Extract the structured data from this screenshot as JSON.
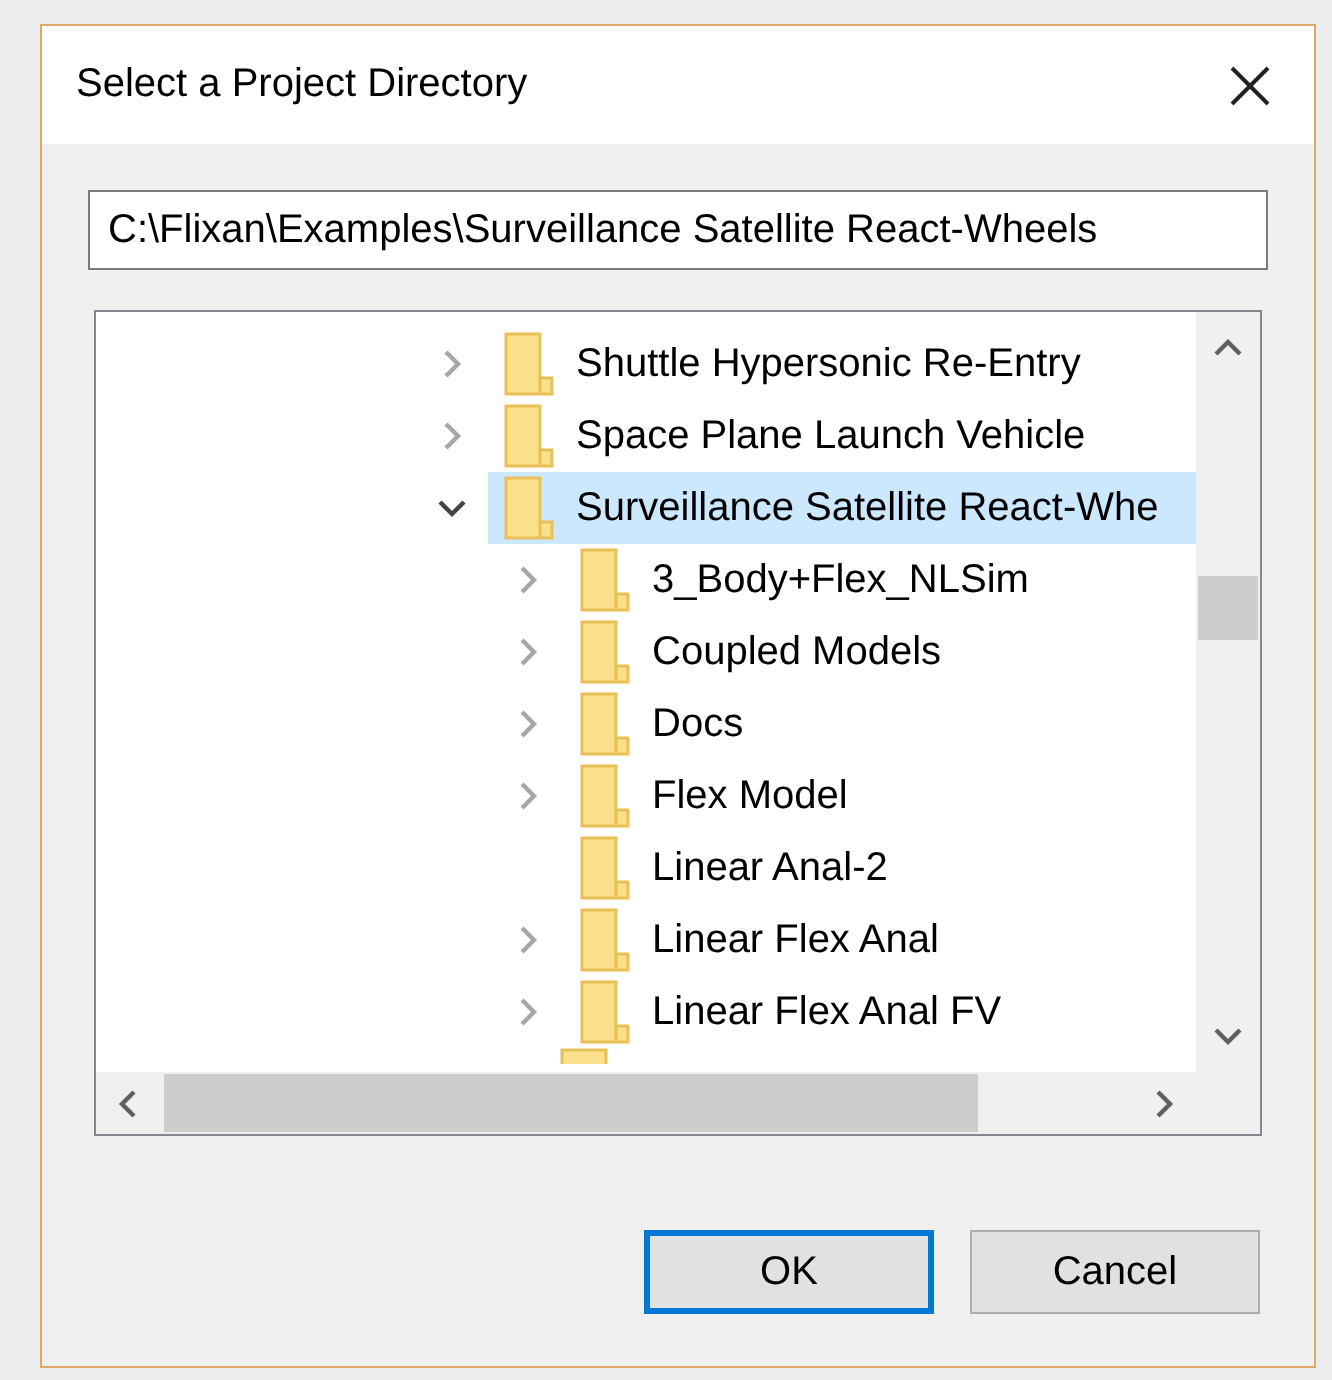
{
  "window": {
    "title": "Select a Project Directory"
  },
  "path_field": {
    "value": "C:\\Flixan\\Examples\\Surveillance Satellite React-Wheels"
  },
  "tree": {
    "items": [
      {
        "label": "Shuttle Hypersonic Re-Entry",
        "kind": "branch",
        "expanded": false,
        "selected": false
      },
      {
        "label": "Space Plane Launch Vehicle",
        "kind": "branch",
        "expanded": false,
        "selected": false
      },
      {
        "label": "Surveillance Satellite React-Whe",
        "kind": "branch",
        "expanded": true,
        "selected": true,
        "children": [
          {
            "label": "3_Body+Flex_NLSim",
            "kind": "branch",
            "expanded": false,
            "selected": false
          },
          {
            "label": "Coupled Models",
            "kind": "branch",
            "expanded": false,
            "selected": false
          },
          {
            "label": "Docs",
            "kind": "branch",
            "expanded": false,
            "selected": false
          },
          {
            "label": "Flex Model",
            "kind": "branch",
            "expanded": false,
            "selected": false
          },
          {
            "label": "Linear Anal-2",
            "kind": "leaf",
            "selected": false
          },
          {
            "label": "Linear Flex Anal",
            "kind": "branch",
            "expanded": false,
            "selected": false
          },
          {
            "label": "Linear Flex Anal FV",
            "kind": "branch",
            "expanded": false,
            "selected": false
          }
        ]
      }
    ]
  },
  "buttons": [
    {
      "label": "OK",
      "default": true
    },
    {
      "label": "Cancel",
      "default": false
    }
  ]
}
